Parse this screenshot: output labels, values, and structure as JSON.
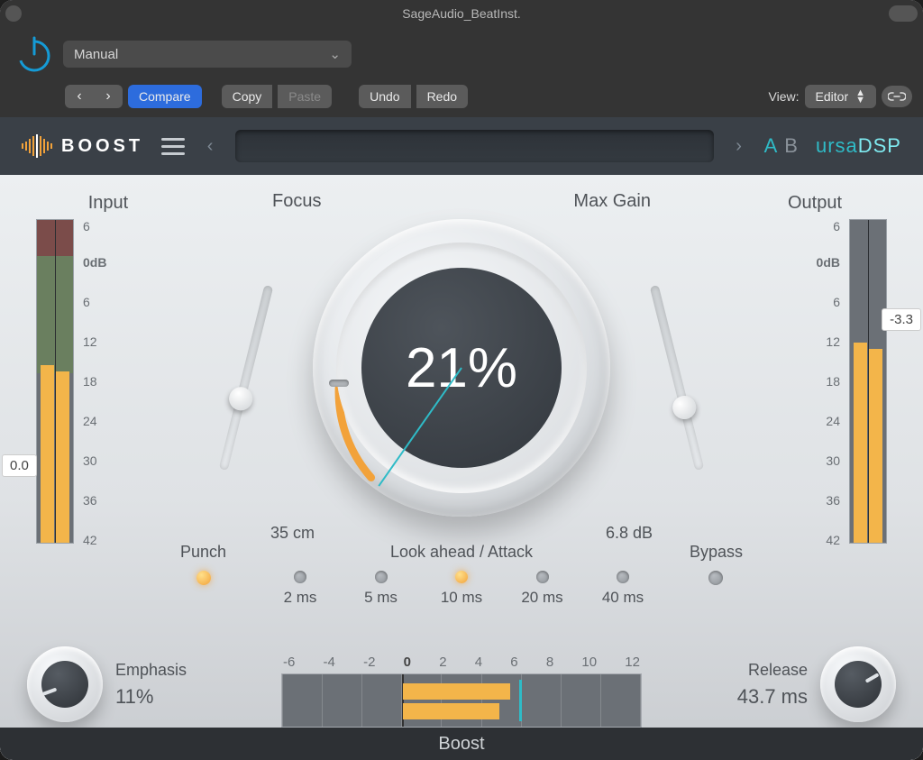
{
  "window_title": "SageAudio_BeatInst.",
  "host": {
    "preset_name": "Manual",
    "nav_prev": "‹",
    "nav_next": "›",
    "compare": "Compare",
    "copy": "Copy",
    "paste": "Paste",
    "undo": "Undo",
    "redo": "Redo",
    "view_label": "View:",
    "view_value": "Editor"
  },
  "plugin": {
    "name": "BOOST",
    "ab_a": "A",
    "ab_b": "B",
    "brand": "ursaDSP"
  },
  "meters": {
    "input": {
      "title": "Input",
      "peak": "0.0",
      "left_level": 0.55,
      "right_level": 0.53
    },
    "output": {
      "title": "Output",
      "peak": "-3.3",
      "left_level": 0.62,
      "right_level": 0.6
    },
    "scale": [
      "6",
      "0dB",
      "6",
      "12",
      "18",
      "24",
      "30",
      "36",
      "42"
    ]
  },
  "dial": {
    "focus_label": "Focus",
    "maxgain_label": "Max Gain",
    "focus_value": "35 cm",
    "maxgain_value": "6.8 dB",
    "boost_value": "21%"
  },
  "lookahead": {
    "title": "Look ahead / Attack",
    "options": [
      {
        "label": "2 ms",
        "on": false
      },
      {
        "label": "5 ms",
        "on": false
      },
      {
        "label": "10 ms",
        "on": true
      },
      {
        "label": "20 ms",
        "on": false
      },
      {
        "label": "40 ms",
        "on": false
      }
    ],
    "punch_label": "Punch",
    "punch_on": true,
    "bypass_label": "Bypass",
    "bypass_on": false
  },
  "bottom": {
    "emphasis_label": "Emphasis",
    "emphasis_value": "11%",
    "release_label": "Release",
    "release_value": "43.7 ms",
    "ruler": [
      "-6",
      "-4",
      "-2",
      "0",
      "2",
      "4",
      "6",
      "8",
      "10",
      "12"
    ]
  },
  "footer": "Boost"
}
